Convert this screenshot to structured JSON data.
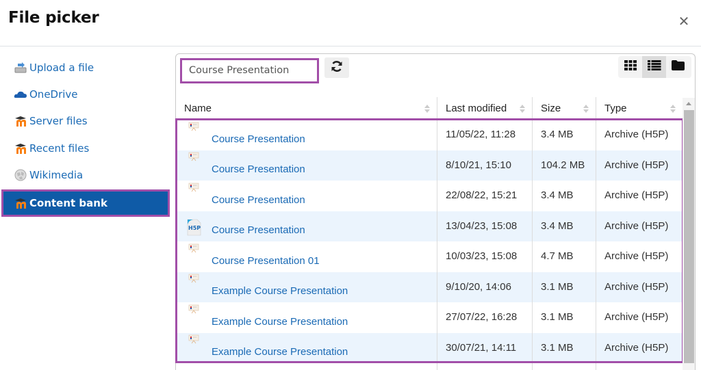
{
  "dialog": {
    "title": "File picker",
    "close_icon": "close-icon"
  },
  "sidebar": {
    "items": [
      {
        "label": "Upload a file",
        "icon": "upload-icon",
        "active": false
      },
      {
        "label": "OneDrive",
        "icon": "onedrive-cloud-icon",
        "active": false
      },
      {
        "label": "Server files",
        "icon": "moodle-icon",
        "active": false
      },
      {
        "label": "Recent files",
        "icon": "moodle-icon",
        "active": false
      },
      {
        "label": "Wikimedia",
        "icon": "wikimedia-globe-icon",
        "active": false
      },
      {
        "label": "Content bank",
        "icon": "moodle-icon",
        "active": true
      }
    ]
  },
  "toolbar": {
    "search_value": "Course Presentation",
    "refresh_icon": "refresh-icon",
    "views": [
      {
        "name": "icons-view",
        "icon": "grid-icon",
        "active": false
      },
      {
        "name": "list-view",
        "icon": "list-icon",
        "active": true
      },
      {
        "name": "tree-view",
        "icon": "folder-icon",
        "active": false
      }
    ]
  },
  "table": {
    "columns": [
      "Name",
      "Last modified",
      "Size",
      "Type"
    ],
    "rows": [
      {
        "name": "Course Presentation",
        "modified": "11/05/22, 11:28",
        "size": "3.4 MB",
        "type": "Archive (H5P)",
        "icon": "presentation-thumbnail-icon"
      },
      {
        "name": "Course Presentation",
        "modified": "8/10/21, 15:10",
        "size": "104.2 MB",
        "type": "Archive (H5P)",
        "icon": "presentation-thumbnail-icon"
      },
      {
        "name": "Course Presentation",
        "modified": "22/08/22, 15:21",
        "size": "3.4 MB",
        "type": "Archive (H5P)",
        "icon": "presentation-thumbnail-icon"
      },
      {
        "name": "Course Presentation",
        "modified": "13/04/23, 15:08",
        "size": "3.4 MB",
        "type": "Archive (H5P)",
        "icon": "h5p-file-icon"
      },
      {
        "name": "Course Presentation 01",
        "modified": "10/03/23, 15:08",
        "size": "4.7 MB",
        "type": "Archive (H5P)",
        "icon": "presentation-thumbnail-icon"
      },
      {
        "name": "Example Course Presentation",
        "modified": "9/10/20, 14:06",
        "size": "3.1 MB",
        "type": "Archive (H5P)",
        "icon": "presentation-thumbnail-icon"
      },
      {
        "name": "Example Course Presentation",
        "modified": "27/07/22, 16:28",
        "size": "3.1 MB",
        "type": "Archive (H5P)",
        "icon": "presentation-thumbnail-icon"
      },
      {
        "name": "Example Course Presentation",
        "modified": "30/07/21, 14:11",
        "size": "3.1 MB",
        "type": "Archive (H5P)",
        "icon": "presentation-thumbnail-icon"
      }
    ]
  },
  "colors": {
    "link": "#1a6ab5",
    "active_bg": "#0f5ba7",
    "highlight": "#a24ea8",
    "row_alt": "#ebf4fd"
  }
}
